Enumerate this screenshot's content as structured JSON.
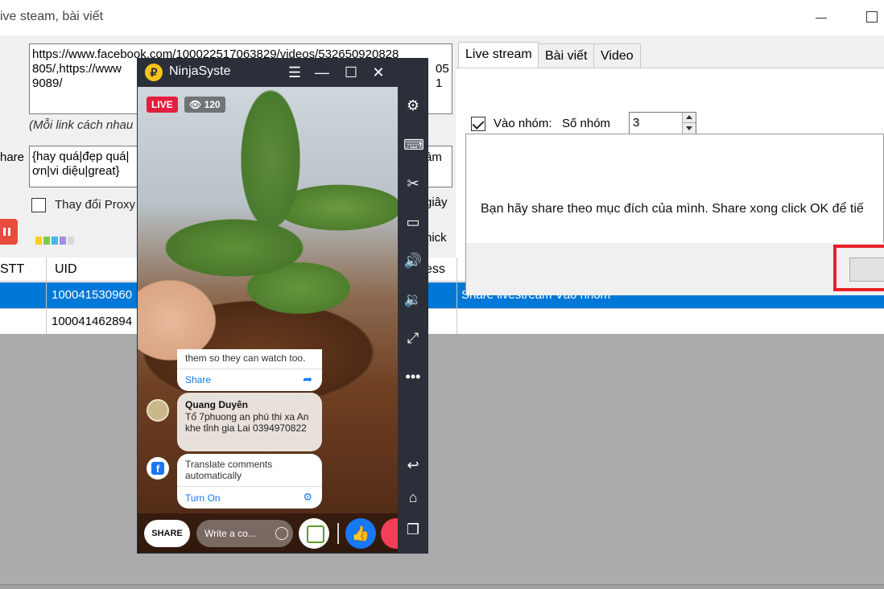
{
  "window": {
    "title": "ive steam, bài viết"
  },
  "form": {
    "links_value": "https://www.facebook.com/100022517063829/videos/532650920828805/,https://www.facebook.com/100022517063829/videos/532650920828805/051 9089/",
    "links_line1": "https://www.facebook.com/100022517063829/videos/532650920828",
    "links_line2": "805/,https://www",
    "links_line2_tail": "051",
    "links_line3": "9089/",
    "note": "(Mỗi link cách nhau",
    "share_label": "hare",
    "share_line1": "{hay quá|đẹp quá|",
    "share_line2": "ơn|vi diệu|great}",
    "share_tail": "âm",
    "proxy_label": "Thay đổi Proxy",
    "right_frag_seconds": "giây",
    "right_frag_click": "nick",
    "progress_colors": [
      "#f7d21c",
      "#7ec850",
      "#4ab6e8",
      "#a98ce0",
      "#d8d8d8"
    ]
  },
  "tabs": {
    "items": [
      {
        "label": "Live stream",
        "active": true
      },
      {
        "label": "Bài viết",
        "active": false
      },
      {
        "label": "Video",
        "active": false
      }
    ],
    "group_checkbox_label": "Vào nhóm:",
    "group_count_label": "Số nhóm",
    "group_count_value": "3"
  },
  "grid": {
    "headers": {
      "stt": "STT",
      "uid": "UID",
      "process": "ess"
    },
    "rows": [
      {
        "uid": "100041530960",
        "status": "Share livestream Vào nhóm",
        "selected": true
      },
      {
        "uid": "100041462894",
        "status": "",
        "selected": false
      }
    ]
  },
  "dialog": {
    "message": "Bạn hãy share theo mục đích của mình. Share xong click OK để tiế",
    "ok_label": ""
  },
  "emulator": {
    "title": "NinjaSyste",
    "logo_glyph": "₽",
    "live_badge": "LIVE",
    "viewer_count": "120",
    "share_card_text": "them so they can watch too.",
    "share_card_link": "Share",
    "comment_name": "Quang Duyên",
    "comment_body": "Tổ 7phuong an phú thi xa An khe tỉnh gia Lai 0394970822",
    "translate_text": "Translate comments automatically",
    "translate_link": "Turn On",
    "share_button": "SHARE",
    "comment_placeholder": "Write a co...",
    "like_glyph": "👍"
  }
}
